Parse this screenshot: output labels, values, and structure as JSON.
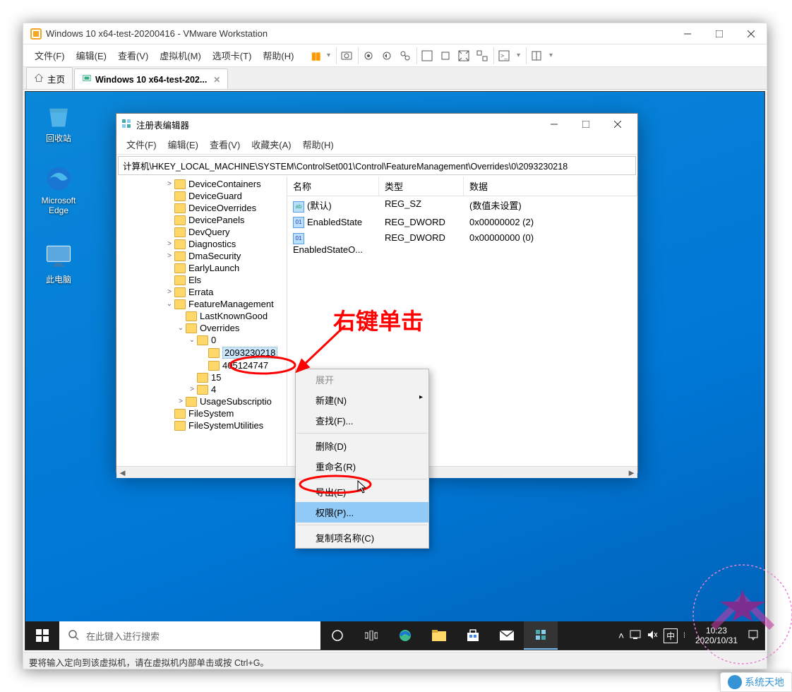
{
  "vmware": {
    "title": "Windows 10 x64-test-20200416 - VMware Workstation",
    "menus": [
      "文件(F)",
      "编辑(E)",
      "查看(V)",
      "虚拟机(M)",
      "选项卡(T)",
      "帮助(H)"
    ],
    "tabs": {
      "home": "主页",
      "vm": "Windows 10 x64-test-202..."
    },
    "status": "要将输入定向到该虚拟机，请在虚拟机内部单击或按 Ctrl+G。"
  },
  "desktop": {
    "recycle": "回收站",
    "edge": "Microsoft Edge",
    "thispc": "此电脑"
  },
  "regedit": {
    "title": "注册表编辑器",
    "menus": [
      "文件(F)",
      "编辑(E)",
      "查看(V)",
      "收藏夹(A)",
      "帮助(H)"
    ],
    "address": "计算机\\HKEY_LOCAL_MACHINE\\SYSTEM\\ControlSet001\\Control\\FeatureManagement\\Overrides\\0\\2093230218",
    "tree": [
      "DeviceContainers",
      "DeviceGuard",
      "DeviceOverrides",
      "DevicePanels",
      "DevQuery",
      "Diagnostics",
      "DmaSecurity",
      "EarlyLaunch",
      "Els",
      "Errata",
      "FeatureManagement",
      "LastKnownGood",
      "Overrides",
      "0",
      "2093230218",
      "405124747",
      "15",
      "4",
      "UsageSubscriptio",
      "FileSystem",
      "FileSystemUtilities"
    ],
    "list": {
      "headers": [
        "名称",
        "类型",
        "数据"
      ],
      "rows": [
        {
          "name": "(默认)",
          "type": "REG_SZ",
          "data": "(数值未设置)"
        },
        {
          "name": "EnabledState",
          "type": "REG_DWORD",
          "data": "0x00000002 (2)"
        },
        {
          "name": "EnabledStateO...",
          "type": "REG_DWORD",
          "data": "0x00000000 (0)"
        }
      ]
    }
  },
  "context_menu": {
    "items": [
      "展开",
      "新建(N)",
      "查找(F)...",
      "删除(D)",
      "重命名(R)",
      "导出(E)",
      "权限(P)...",
      "复制项名称(C)"
    ]
  },
  "annotation": {
    "label": "右键单击"
  },
  "taskbar": {
    "search_placeholder": "在此键入进行搜索",
    "ime": "中",
    "clock": {
      "time": "10:23",
      "date": "2020/10/31"
    }
  },
  "watermark": "系统天地"
}
